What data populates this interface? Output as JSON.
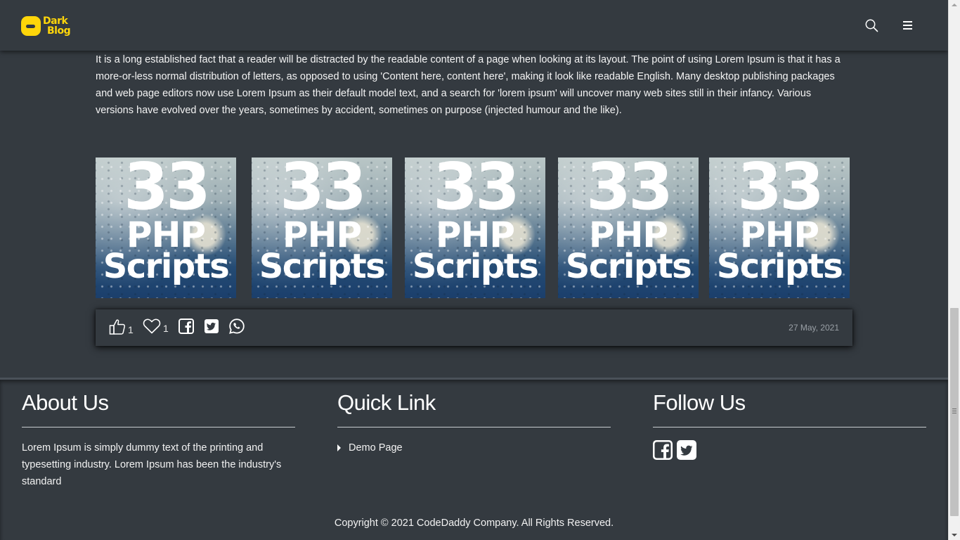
{
  "header": {
    "logo_line1": "Dark",
    "logo_line2": "Blog",
    "search_icon": "search-icon",
    "menu_icon": "hamburger-menu-icon"
  },
  "article": {
    "body": "It is a long established fact that a reader will be distracted by the readable content of a page when looking at its layout. The point of using Lorem Ipsum is that it has a more-or-less normal distribution of letters, as opposed to using 'Content here, content here', making it look like readable English. Many desktop publishing packages and web page editors now use Lorem Ipsum as their default model text, and a search for 'lorem ipsum' will uncover many web sites still in their infancy. Various versions have evolved over the years, sometimes by accident, sometimes on purpose (injected humour and the like).",
    "thumbnails": [
      {
        "line1": "33",
        "line2": "PHP",
        "line3": "Scripts"
      },
      {
        "line1": "33",
        "line2": "PHP",
        "line3": "Scripts"
      },
      {
        "line1": "33",
        "line2": "PHP",
        "line3": "Scripts"
      },
      {
        "line1": "33",
        "line2": "PHP",
        "line3": "Scripts"
      },
      {
        "line1": "33",
        "line2": "PHP",
        "line3": "Scripts"
      }
    ]
  },
  "actions": {
    "like_count": "1",
    "heart_count": "1",
    "date": "27 May, 2021",
    "icons": [
      "thumbs-up-icon",
      "heart-icon",
      "facebook-icon",
      "twitter-icon",
      "whatsapp-icon"
    ]
  },
  "footer": {
    "about": {
      "title": "About Us",
      "text": "Lorem Ipsum is simply dummy text of the printing and typesetting industry. Lorem Ipsum has been the industry's standard"
    },
    "quick_link": {
      "title": "Quick Link",
      "items": [
        {
          "label": "Demo Page"
        }
      ]
    },
    "follow": {
      "title": "Follow Us",
      "icons": [
        "facebook-square-icon",
        "twitter-square-icon"
      ]
    },
    "copyright": "Copyright © 2021  CodeDaddy Company. All Rights Reserved."
  },
  "colors": {
    "background": "#343a40",
    "accent": "#ffd60a",
    "text": "#ffffff",
    "muted": "#9aa0a6"
  },
  "scroll": {
    "position_fraction": 0.57
  }
}
